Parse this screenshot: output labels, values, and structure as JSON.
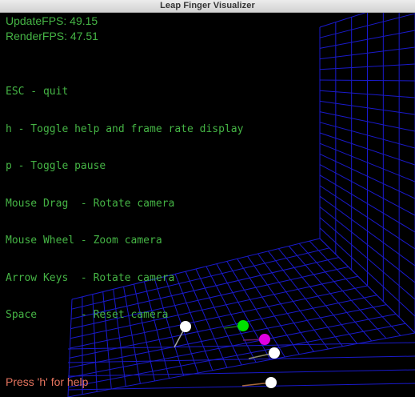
{
  "window": {
    "title": "Leap Finger Visualizer"
  },
  "stats": {
    "update_fps": "UpdateFPS: 49.15",
    "render_fps": "RenderFPS: 47.51"
  },
  "help": {
    "lines": [
      "ESC - quit",
      "h - Toggle help and frame rate display",
      "p - Toggle pause",
      "Mouse Drag  - Rotate camera",
      "Mouse Wheel - Zoom camera",
      "Arrow Keys  - Rotate camera",
      "Space       - Reset camera"
    ]
  },
  "footer": {
    "hint": "Press 'h' for help"
  },
  "colors": {
    "grid": "#1a1acc",
    "help_text": "#45b445",
    "hint_text": "#e8755f",
    "title_bar": "#dcdcdc"
  },
  "scene": {
    "fingers": [
      {
        "name": "finger-1",
        "color": "#ffffff",
        "tail_color": "#a8a8a8"
      },
      {
        "name": "finger-2",
        "color": "#00e000",
        "tail_color": "#1e6e1e"
      },
      {
        "name": "finger-3",
        "color": "#e000e0",
        "tail_color": "#6a1a6a"
      },
      {
        "name": "finger-4",
        "color": "#ffffff",
        "tail_color": "#8a8a6a"
      },
      {
        "name": "finger-5",
        "color": "#ffffff",
        "tail_color": "#a86a3a"
      }
    ]
  }
}
